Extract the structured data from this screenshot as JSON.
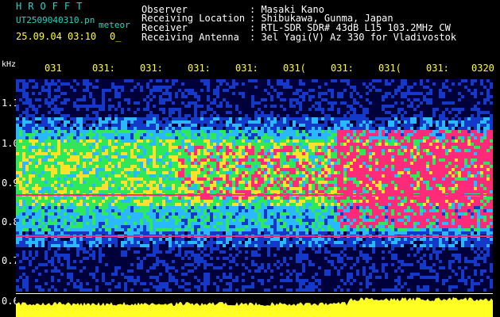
{
  "header": {
    "title": "HROFFT",
    "filename": "UT2509040310.pn",
    "meteor_label": "meteor",
    "datetime": "25.09.04 03:10",
    "datetime_tail": "0_"
  },
  "info": [
    {
      "label": "Observer",
      "value": ": Masaki Kano"
    },
    {
      "label": "Receiving Location",
      "value": ": Shibukawa, Gunma, Japan"
    },
    {
      "label": "Receiver",
      "value": ": RTL-SDR SDR# 43dB L15 103.2MHz CW"
    },
    {
      "label": "Receiving Antenna",
      "value": ": 3el Yagi(V) Az 330 for Vladivostok"
    }
  ],
  "axis": {
    "unit": "kHz",
    "freq_ticks": [
      "1.1",
      "1.0",
      "0.9",
      "0.8",
      "0.7",
      "0.6"
    ],
    "time_ticks": [
      "031",
      "031:",
      "031:",
      "031:",
      "031:",
      "031(",
      "031:",
      "031(",
      "031:",
      "0320"
    ]
  },
  "colors": {
    "background": "#000000",
    "spectrum_bg": "#00003a",
    "hot": "#ff2a7a",
    "warm": "#ffe02a",
    "mid": "#2ee85a",
    "cool": "#2ab8ff",
    "cold": "#1438c8",
    "amplitude": "#ffff24",
    "label_cyan": "#1fd7c8",
    "label_yellow": "#ffff24"
  }
}
